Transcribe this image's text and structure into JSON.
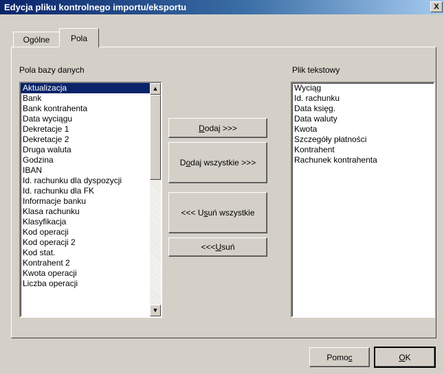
{
  "window": {
    "title": "Edycja pliku kontrolnego importu/eksportu",
    "close_glyph": "X"
  },
  "tabs": [
    {
      "label": "Ogólne"
    },
    {
      "label": "Pola"
    }
  ],
  "db_fields": {
    "label": "Pola bazy danych",
    "items": [
      "Aktualizacja",
      "Bank",
      "Bank kontrahenta",
      "Data  wyciągu",
      "Dekretacje 1",
      "Dekretacje 2",
      "Druga waluta",
      "Godzina",
      "IBAN",
      "Id. rachunku dla dyspozycji",
      "Id. rachunku dla FK",
      "Informacje banku",
      "Klasa rachunku",
      "Klasyfikacja",
      "Kod operacji",
      "Kod operacji 2",
      "Kod stat.",
      "Kontrahent 2",
      "Kwota operacji",
      "Liczba operacji"
    ],
    "selected_index": 0
  },
  "text_file": {
    "label": "Plik tekstowy",
    "items": [
      "Wyciąg",
      "Id. rachunku",
      "Data księg.",
      "Data waluty",
      "Kwota",
      "Szczegóły płatności",
      "Kontrahent",
      "Rachunek kontrahenta"
    ]
  },
  "buttons": {
    "add": {
      "prefix": "",
      "mnemonic": "D",
      "rest": "odaj >>>"
    },
    "add_all": {
      "prefix": "D",
      "mnemonic": "o",
      "rest": "daj wszystkie >>>"
    },
    "remove_all": {
      "prefix": "<<< U",
      "mnemonic": "s",
      "rest": "uń wszystkie"
    },
    "remove": {
      "prefix": "<<< ",
      "mnemonic": "U",
      "rest": "suń"
    },
    "help": {
      "prefix": "Pomo",
      "mnemonic": "c",
      "rest": ""
    },
    "ok": {
      "prefix": "",
      "mnemonic": "O",
      "rest": "K"
    }
  }
}
